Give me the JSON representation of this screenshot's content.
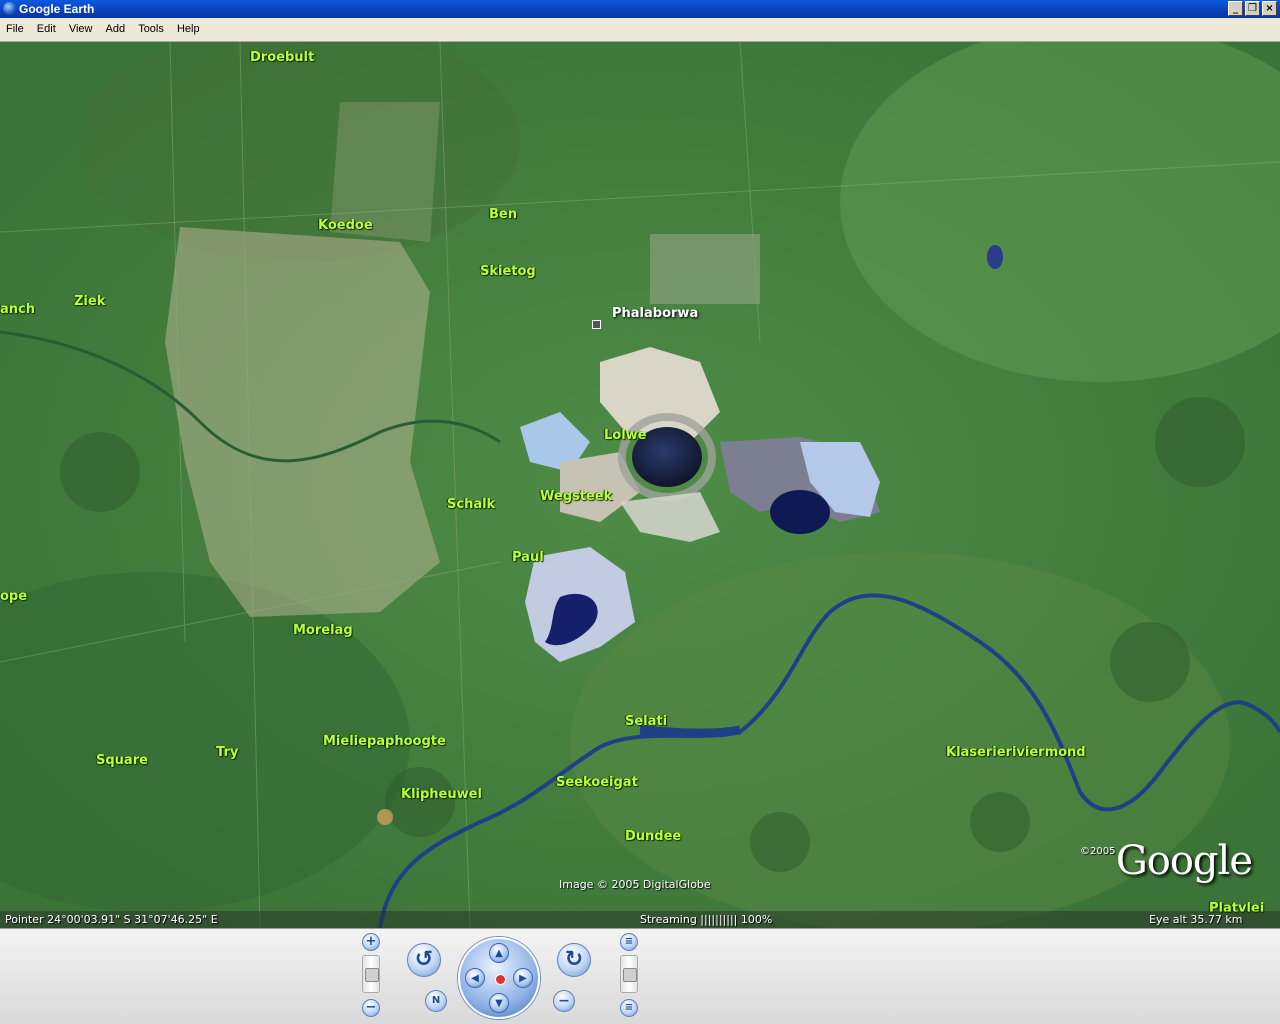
{
  "window": {
    "title": "Google Earth",
    "buttons": [
      "_",
      "❐",
      "×"
    ]
  },
  "menu": [
    "File",
    "Edit",
    "View",
    "Add",
    "Tools",
    "Help"
  ],
  "map": {
    "labels": {
      "droebult": "Droebult",
      "ben": "Ben",
      "koedoe": "Koedoe",
      "skietog": "Skietog",
      "anch": "anch",
      "ziek": "Ziek",
      "phalaborwa": "Phalaborwa",
      "lolwe": "Lolwe",
      "wegsteek": "Wegsteek",
      "schalk": "Schalk",
      "paul": "Paul",
      "ope": "ope",
      "morelag": "Morelag",
      "selati": "Selati",
      "mieliepaphoogte": "Mieliepaphoogte",
      "try": "Try",
      "square": "Square",
      "klipheuwel": "Klipheuwel",
      "seekoeigat": "Seekoeigat",
      "dundee": "Dundee",
      "klaserierivier": "Klaserieriviermond",
      "platvlei": "Platvlei"
    },
    "image_credit": "Image © 2005 DigitalGlobe",
    "google_copyright": "©2005",
    "google_logo": "Google"
  },
  "status": {
    "pointer": "Pointer  24°00'03.91\"  S    31°07'46.25\"  E",
    "streaming": "Streaming ||||||||||  100%",
    "eye_alt": "Eye  alt    35.77 km"
  },
  "colors": {
    "titlebar": "#0b3fb8",
    "place_label": "#b9ff3a",
    "nav_button": "#6c93cf"
  },
  "icons": {
    "zoom_in": "+",
    "zoom_out": "−",
    "rotate_ccw": "↺",
    "rotate_cw": "↻",
    "north": "N",
    "up": "▲",
    "down": "▼",
    "left": "◀",
    "right": "▶",
    "tilt_up": "≡",
    "tilt_down": "≡"
  }
}
